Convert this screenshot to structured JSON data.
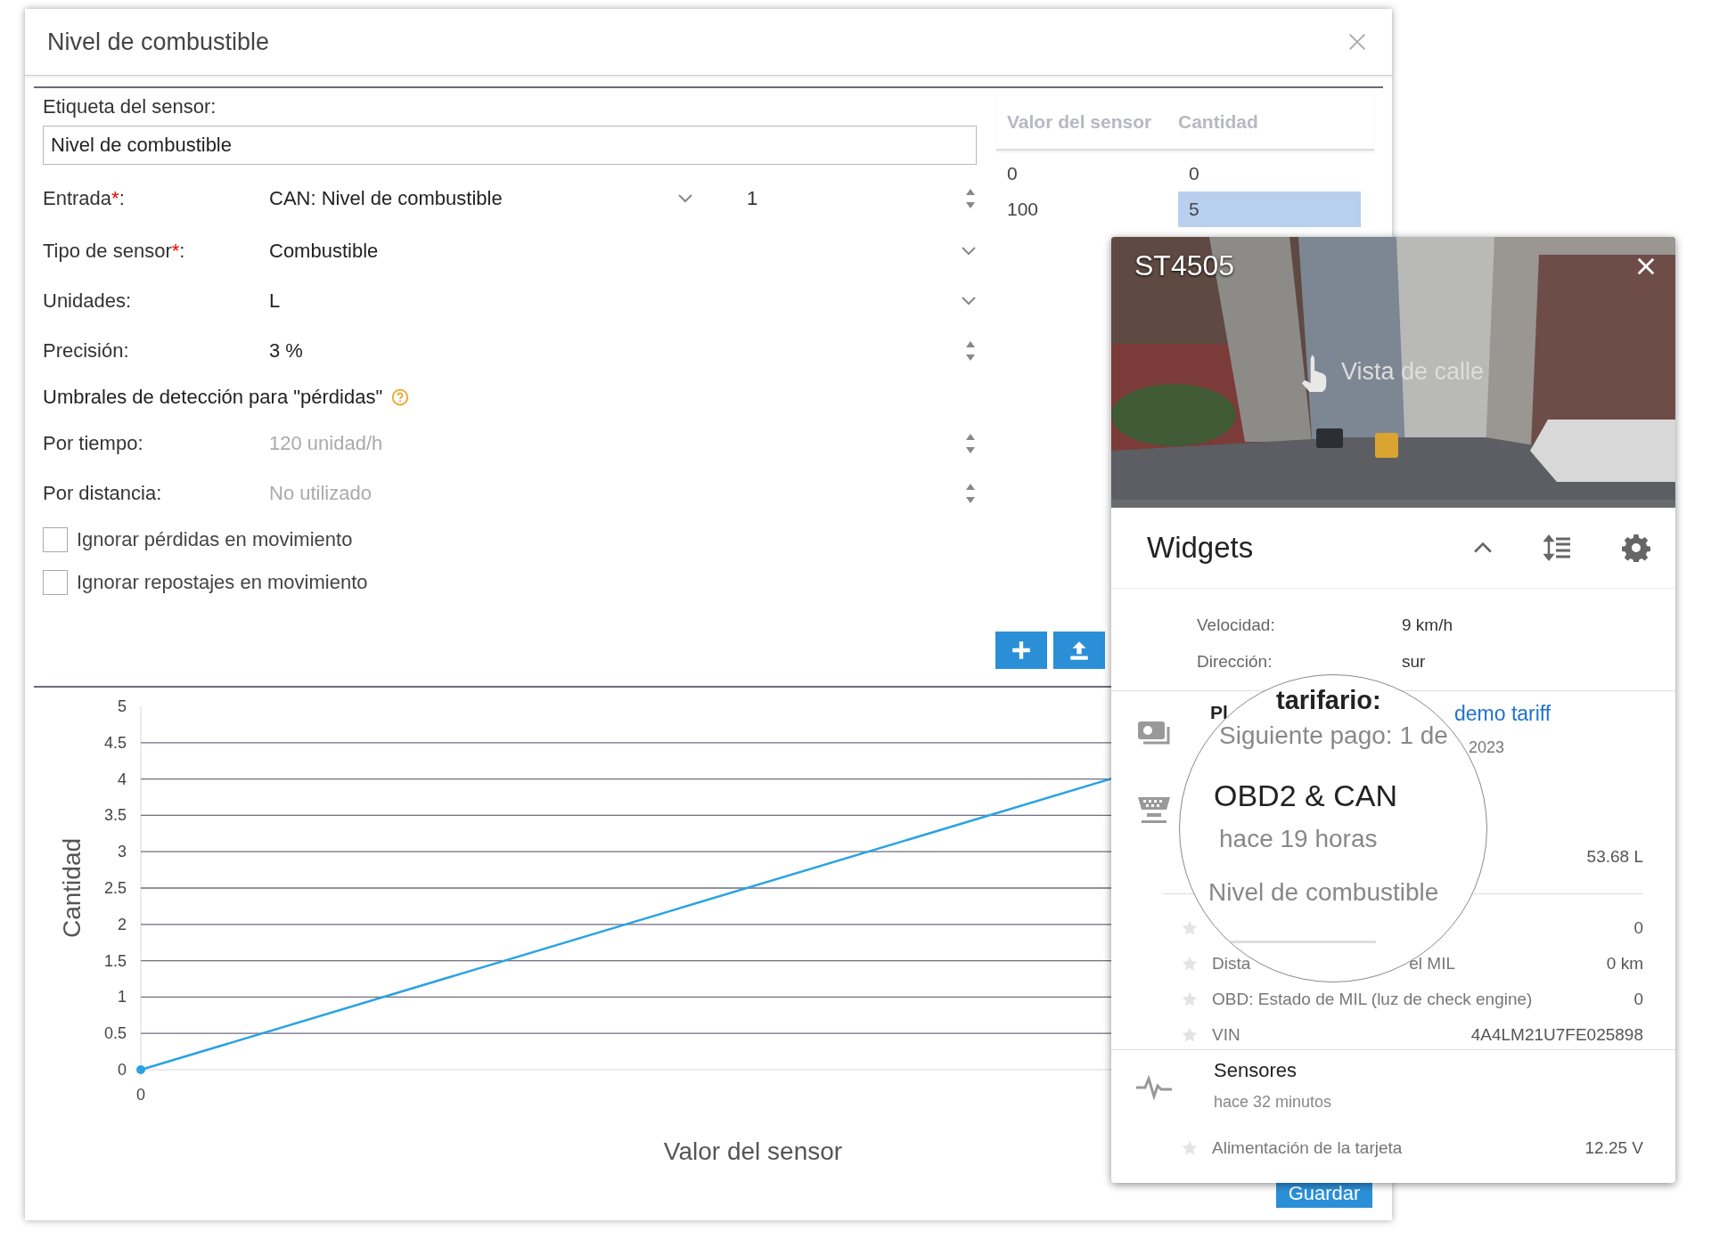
{
  "dialog": {
    "title": "Nivel de combustible"
  },
  "form": {
    "name_label": "Etiqueta del sensor:",
    "name_value": "Nivel de combustible",
    "rows": [
      {
        "kind": "select_number",
        "label": "Entrada",
        "mark": "*",
        "suffix": ":",
        "value": "CAN: Nivel de combustible",
        "number": "1"
      },
      {
        "kind": "select",
        "label": "Tipo de sensor",
        "mark": "*",
        "suffix": ":",
        "value": "Combustible"
      },
      {
        "kind": "select",
        "label": "Unidades:",
        "value": "L"
      },
      {
        "kind": "spinner",
        "label": "Precisión:",
        "value": "3 %"
      },
      {
        "kind": "heading",
        "label": "Umbrales de detección para \"pérdidas\""
      },
      {
        "kind": "spinner",
        "label": "Por tiempo:",
        "placeholder": "120 unidad/h"
      },
      {
        "kind": "spinner",
        "label": "Por distancia:",
        "placeholder": "No utilizado"
      },
      {
        "kind": "checkbox",
        "label": "Ignorar pérdidas en movimiento",
        "checked": false
      },
      {
        "kind": "checkbox",
        "label": "Ignorar repostajes en movimiento",
        "checked": false
      }
    ]
  },
  "table": {
    "columns": [
      "Valor del sensor",
      "Cantidad"
    ],
    "rows": [
      {
        "cells": [
          {
            "text": "0",
            "selected": false
          },
          {
            "text": "0",
            "selected": false
          }
        ]
      },
      {
        "cells": [
          {
            "text": "100",
            "selected": false
          },
          {
            "text": "5",
            "selected": true
          }
        ]
      }
    ]
  },
  "chart": {
    "y_title": "Cantidad",
    "x_title": "Valor del sensor",
    "y_ticks": [
      "5",
      "4.5",
      "4",
      "3.5",
      "3",
      "2.5",
      "2",
      "1.5",
      "1",
      "0.5",
      "0"
    ],
    "x_ticks": [
      "0"
    ]
  },
  "footer": {
    "save": "Guardar"
  },
  "unit_popup": {
    "title": "ST4505",
    "photo": {
      "kind": "picture",
      "label": "Vista de calle"
    },
    "widgets": {
      "title": "Widgets",
      "expanded": true
    },
    "position": [
      {
        "label": "Velocidad:",
        "value": "9 km/h"
      },
      {
        "label": "Dirección:",
        "value": "sur"
      }
    ],
    "tariff": {
      "prefix": "Pl",
      "link": "demo tariff",
      "date_tail": "2023"
    },
    "obd": {
      "value": "53.68 L",
      "params": [
        {
          "value": "0"
        },
        {
          "label_parts": [
            "Dista",
            "el MIL"
          ],
          "value": "0 km"
        },
        {
          "label_parts": [
            "OBD: Estado de MIL (luz de check engine)"
          ],
          "value": "0"
        },
        {
          "label_parts": [
            "VIN"
          ],
          "value": "4A4LM21U7FE025898"
        }
      ]
    },
    "sensors": {
      "title": "Sensores",
      "time": "hace 32 minutos",
      "params": [
        {
          "label_parts": [
            "Alimentación de la tarjeta"
          ],
          "value": "12.25 V"
        }
      ]
    },
    "magnifier": {
      "lines": [
        {
          "kind": "clipped",
          "text": "tarifario:"
        },
        {
          "kind": "sub",
          "text": "Siguiente pago: 1 de"
        },
        {
          "kind": "heading",
          "text": "OBD2 & CAN"
        },
        {
          "kind": "sub",
          "text": "hace 19 horas"
        },
        {
          "kind": "label",
          "text": "Nivel de combustible"
        }
      ]
    }
  }
}
